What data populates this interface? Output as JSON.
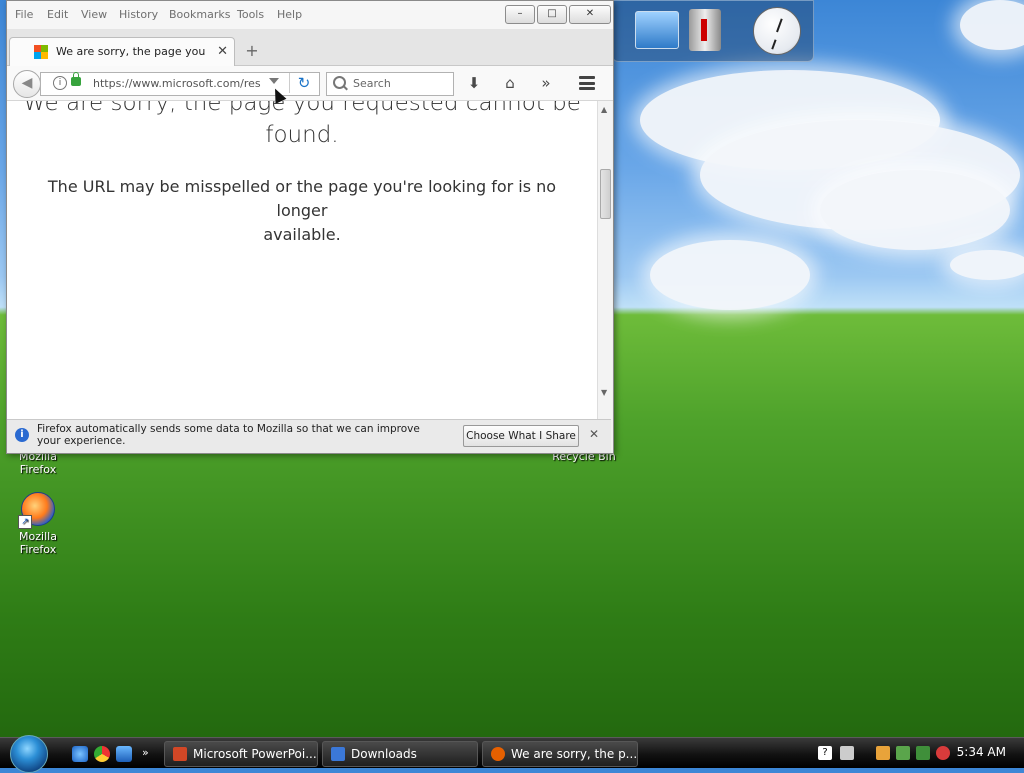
{
  "desktop": {
    "icons": [
      {
        "label": "Mozilla Firefox"
      },
      {
        "label": "Mozilla Firefox"
      },
      {
        "label": "Recycle Bin"
      }
    ]
  },
  "window": {
    "menus": [
      "File",
      "Edit",
      "View",
      "History",
      "Bookmarks",
      "Tools",
      "Help"
    ],
    "controls": {
      "minimize": "–",
      "maximize": "□",
      "close": "✕"
    },
    "tab": {
      "title": "We are sorry, the page you r...",
      "close": "✕",
      "new_tab": "+"
    },
    "nav": {
      "url": "https://www.microsoft.com/resour",
      "search_placeholder": "Search",
      "icons": [
        "back-icon",
        "info-icon",
        "lock-icon",
        "dropdown-icon",
        "reload-icon",
        "search-icon",
        "download-icon",
        "home-icon",
        "overflow-icon",
        "menu-icon"
      ]
    },
    "page": {
      "heading_line1": "We are sorry, the page you requested cannot be",
      "heading_line2": "found.",
      "message_line1": "The URL may be misspelled or the page you're looking for is no longer",
      "message_line2": "available."
    },
    "notification": {
      "text": "Firefox automatically sends some data to Mozilla so that we can improve your experience.",
      "button": "Choose What I Share",
      "close": "✕"
    }
  },
  "taskbar": {
    "buttons": [
      {
        "label": "Microsoft PowerPoi...",
        "color": "#d24726"
      },
      {
        "label": "Downloads",
        "color": "#3b78d8"
      },
      {
        "label": "We are sorry, the p...",
        "color": "#e66000"
      }
    ],
    "time": "5:34 AM"
  }
}
